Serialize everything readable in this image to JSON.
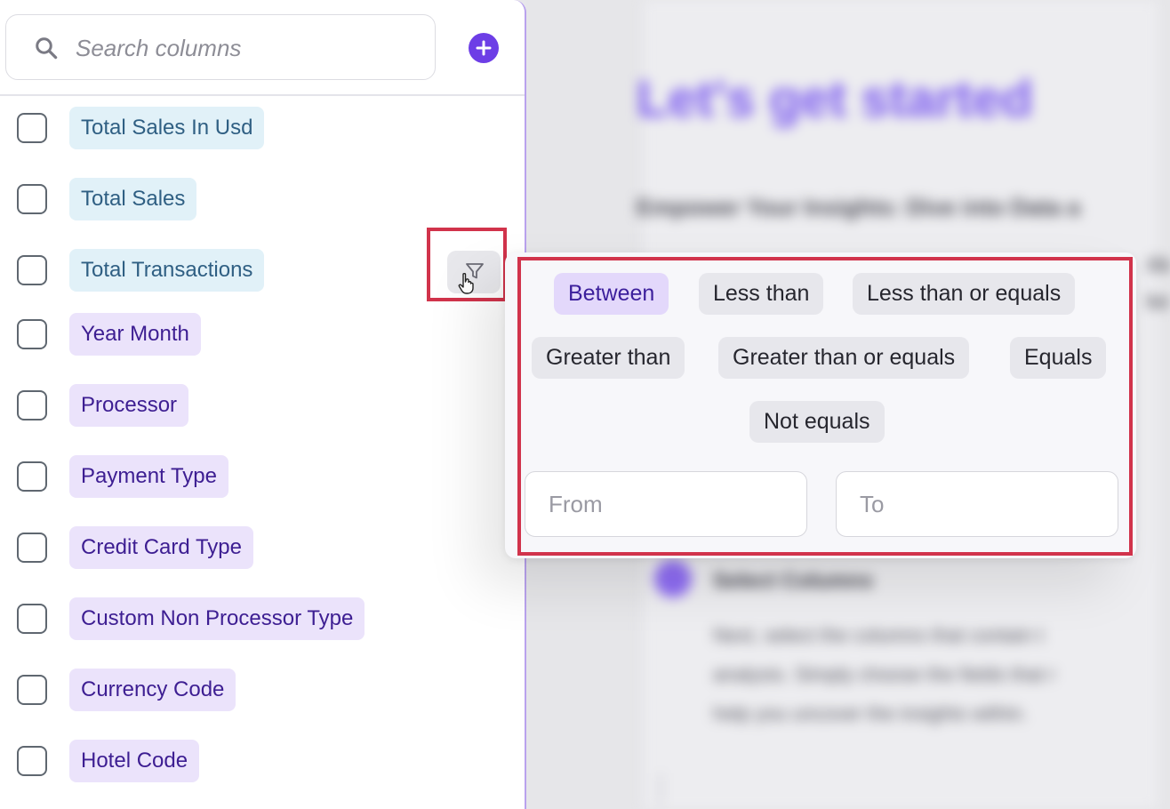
{
  "background": {
    "title": "Let's get started",
    "subtitle": "Empower Your Insights: Dive into Data a",
    "fragments": [
      "da",
      "ke"
    ],
    "step": {
      "title": "Select Columns",
      "lines": [
        "Next, select the columns that contain t",
        "analysis. Simply choose the fields that r",
        "help you uncover the insights within."
      ]
    }
  },
  "search": {
    "placeholder": "Search columns",
    "value": ""
  },
  "columns": [
    {
      "label": "Total Sales In Usd",
      "color": "blue"
    },
    {
      "label": "Total Sales",
      "color": "blue"
    },
    {
      "label": "Total Transactions",
      "color": "blue"
    },
    {
      "label": "Year Month",
      "color": "purple"
    },
    {
      "label": "Processor",
      "color": "purple"
    },
    {
      "label": "Payment Type",
      "color": "purple"
    },
    {
      "label": "Credit Card Type",
      "color": "purple"
    },
    {
      "label": "Custom Non Processor Type",
      "color": "purple"
    },
    {
      "label": "Currency Code",
      "color": "purple"
    },
    {
      "label": "Hotel Code",
      "color": "purple"
    }
  ],
  "filter": {
    "operators": [
      {
        "label": "Between",
        "active": true
      },
      {
        "label": "Less than"
      },
      {
        "label": "Less than or equals"
      },
      {
        "label": "Greater than"
      },
      {
        "label": "Greater than or equals"
      },
      {
        "label": "Equals"
      },
      {
        "label": "Not equals"
      }
    ],
    "from_placeholder": "From",
    "to_placeholder": "To"
  },
  "colors": {
    "accent": "#6d3ee6",
    "highlight": "#d1334b",
    "tag_blue_bg": "#e1f1f8",
    "tag_purple_bg": "#ebe3fb"
  },
  "icons": {
    "search": "search-icon",
    "add": "plus-circle-icon",
    "filter": "funnel-icon",
    "cursor": "hand-pointer-icon"
  }
}
